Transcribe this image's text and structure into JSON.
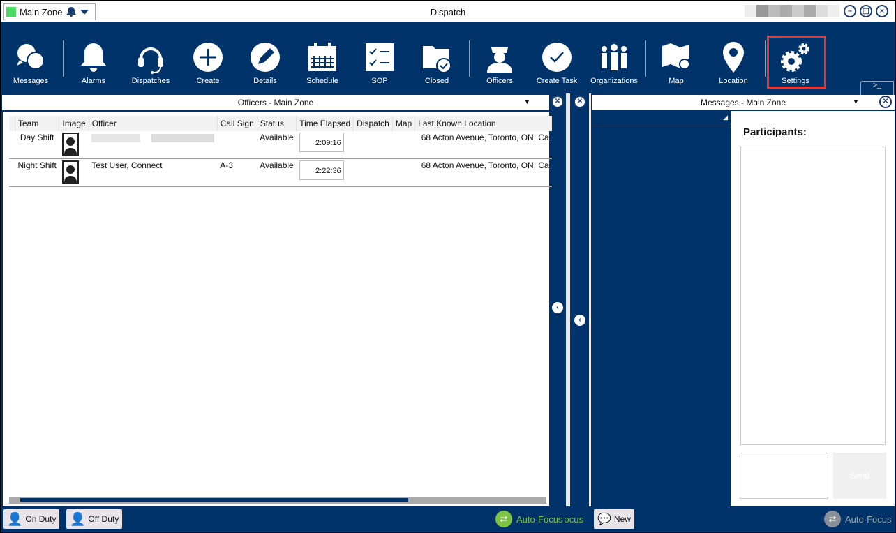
{
  "titlebar": {
    "zone": "Main Zone",
    "title": "Dispatch",
    "zone_color": "#4cd964"
  },
  "toolbar": {
    "items": [
      {
        "label": "Messages",
        "icon": "chat-bubbles-icon"
      },
      {
        "label": "Alarms",
        "icon": "bell-icon"
      },
      {
        "label": "Dispatches",
        "icon": "headset-icon"
      },
      {
        "label": "Create",
        "icon": "plus-circle-icon"
      },
      {
        "label": "Details",
        "icon": "pencil-icon"
      },
      {
        "label": "Schedule",
        "icon": "calendar-icon"
      },
      {
        "label": "SOP",
        "icon": "checklist-icon"
      },
      {
        "label": "Closed",
        "icon": "folder-check-icon"
      },
      {
        "label": "Officers",
        "icon": "officer-icon"
      },
      {
        "label": "Create Task",
        "icon": "check-circle-icon"
      },
      {
        "label": "Organizations",
        "icon": "people-icon"
      },
      {
        "label": "Map",
        "icon": "map-icon"
      },
      {
        "label": "Location",
        "icon": "pin-icon"
      },
      {
        "label": "Settings",
        "icon": "gears-icon"
      }
    ],
    "console": ">_"
  },
  "officers": {
    "title": "Officers - Main Zone",
    "columns": [
      "Team",
      "Image",
      "Officer",
      "Call Sign",
      "Status",
      "Time Elapsed",
      "Dispatch",
      "Map",
      "Last Known Location"
    ],
    "rows": [
      {
        "team": "Day Shift",
        "officer": "",
        "call_sign": "",
        "status": "Available",
        "time": "2:09:16",
        "dispatch": "",
        "map": "",
        "location": "68 Acton Avenue, Toronto, ON, Ca"
      },
      {
        "team": "Night Shift",
        "officer": "Test User, Connect",
        "call_sign": "A-3",
        "status": "Available",
        "time": "2:22:36",
        "dispatch": "",
        "map": "",
        "location": "68 Acton Avenue, Toronto, ON, Ca"
      }
    ]
  },
  "messages": {
    "title": "Messages - Main Zone",
    "participants": "Participants:",
    "send": "Send"
  },
  "bottom": {
    "on_duty": "On Duty",
    "off_duty": "Off Duty",
    "auto_focus": "Auto-Focus",
    "auto_focus_clipped": "ocus",
    "new": "New",
    "auto_focus2": "Auto-Focus"
  },
  "colors": {
    "navy": "#00336a",
    "highlight": "#e53935",
    "autofocus_active": "#7dc242"
  }
}
